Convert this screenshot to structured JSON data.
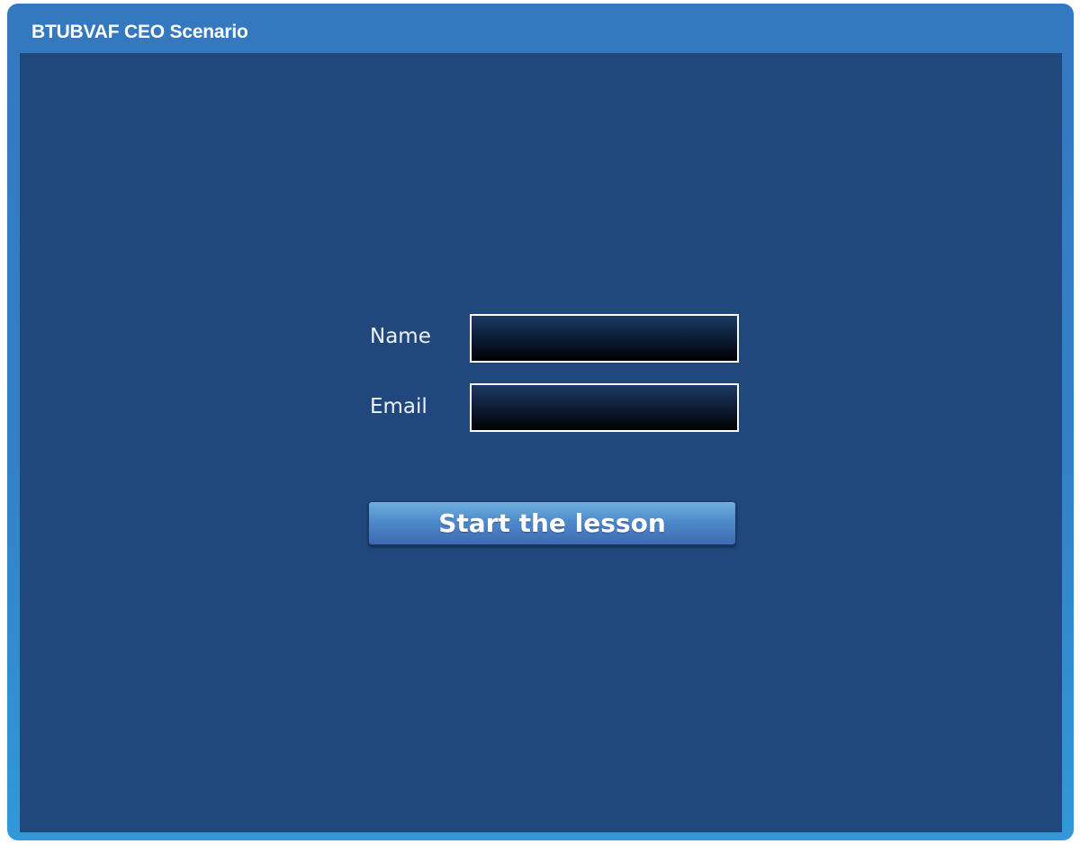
{
  "window": {
    "title": "BTUBVAF CEO Scenario"
  },
  "form": {
    "name_label": "Name",
    "name_value": "",
    "email_label": "Email",
    "email_value": "",
    "start_button_label": "Start the lesson"
  },
  "colors": {
    "window_frame": "#3380c6",
    "stage_background": "#20487c",
    "field_background": "#0b1a30",
    "button_accent": "#4e8acb"
  }
}
